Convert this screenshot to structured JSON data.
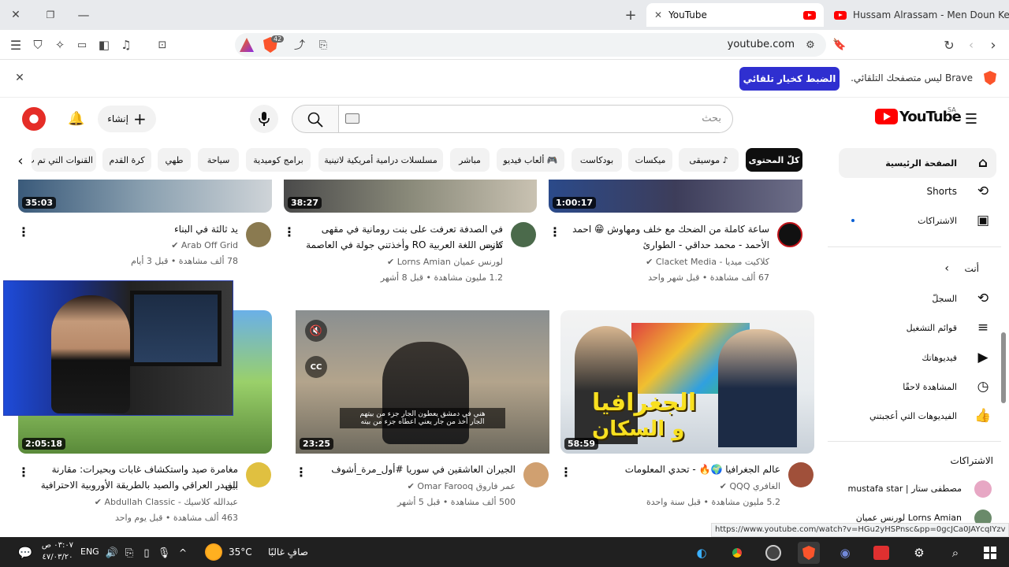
{
  "browser": {
    "tabs": [
      {
        "label": "YouTube"
      },
      {
        "label": "Hussam Alrassam - Men Doun Kel Lb"
      }
    ],
    "address": "youtube.com",
    "shield_count": "42"
  },
  "notice": {
    "text": "Brave ليس متصفحك التلقائي.",
    "button": "الضبط كخيار تلقائي"
  },
  "header": {
    "logo": "YouTube",
    "region": "SA",
    "search_placeholder": "بحث",
    "create_label": "إنشاء"
  },
  "chips": [
    "كلّ المحتوى",
    "موسيقى",
    "ميكسات",
    "بودكاست",
    "ألعاب فيديو",
    "مباشر",
    "مسلسلات درامية أمريكية لاتينية",
    "برامج كوميدية",
    "سياحة",
    "طهي",
    "كرة القدم",
    "القنوات التي تم ت"
  ],
  "sidebar": {
    "main": [
      {
        "label": "الصفحة الرئيسية",
        "icon": "home-icon"
      },
      {
        "label": "Shorts",
        "icon": "shorts-icon"
      },
      {
        "label": "الاشتراكات",
        "icon": "subscriptions-icon"
      }
    ],
    "you_label": "أنت",
    "you_items": [
      {
        "label": "السجلّ",
        "icon": "history-icon"
      },
      {
        "label": "قوائم التشغيل",
        "icon": "playlist-icon"
      },
      {
        "label": "فيديوهاتك",
        "icon": "your-videos-icon"
      },
      {
        "label": "المشاهدة لاحقًا",
        "icon": "watch-later-icon"
      },
      {
        "label": "الفيديوهات التي أعجبتني",
        "icon": "like-icon"
      }
    ],
    "subs_label": "الاشتراكات",
    "subs": [
      {
        "label": "mustafa star | مصطفى ستار"
      },
      {
        "label": "لورنس عميان Lorns Amian"
      }
    ]
  },
  "videos_row1": [
    {
      "duration": "1:00:17",
      "title1": "ساعة كاملة من الضحك مع خلف ومهاوش 😁 احمد",
      "title2": "الأحمد - محمد حداقي - الطوارئ",
      "channel": "كلاكيت ميديا - Clacket Media",
      "meta": "67 ألف مشاهدة • قبل شهر واحد"
    },
    {
      "duration": "38:27",
      "title1": "في الصدفة تعرفت على بنت رومانية في مقهى كانت",
      "title2": "تدرس اللغة العربية RO وأخذتني جولة في العاصمة",
      "channel": "لورنس عميان Lorns Amian",
      "meta": "1.2 مليون مشاهدة • قبل 8 أشهر"
    },
    {
      "duration": "35:03",
      "title1": "يد ثالثة في البناء",
      "title2": "",
      "channel": "Arab Off Grid",
      "meta": "78 ألف مشاهدة • قبل 3 أيام"
    }
  ],
  "videos_row2": [
    {
      "duration": "58:59",
      "title1": "عالم الجغرافيا 🌍🔥 - تحدي المعلومات",
      "channel": "الغافري QQQ",
      "meta": "5.2 مليون مشاهدة • قبل سنة واحدة",
      "thumb_text1": "الجغرافيا",
      "thumb_text2": "و السكان"
    },
    {
      "duration": "23:25",
      "title1": "الجيران العاشقين في سوريا #أول_مرة_أشوف",
      "channel": "عمر فاروق Omar Farooq",
      "meta": "500 ألف مشاهدة • قبل 5 أشهر",
      "caption1": "هني في دمشق يعطون الجار جزء من بيتهم",
      "caption2": "الجار أخذ من جار يعني اعطاه جزء من بيته"
    },
    {
      "duration": "2:05:18",
      "title1": "مغامرة صيد واستكشاف غابات وبحيرات: مقارنة بين",
      "title2": "الفيدر العراقي والصيد بالطريقة الأوروبية الاحترافية",
      "channel": "عبدالله كلاسيك - Abdullah Classic",
      "meta": "463 ألف مشاهدة • قبل يوم واحد"
    }
  ],
  "status_url": "https://www.youtube.com/watch?v=HGu2yHSPnsc&pp=0gcJCa0JAYcqIYzv",
  "taskbar": {
    "weather_temp": "35°C",
    "weather_text": "صافٍ غالبًا",
    "lang": "ENG",
    "time": "٠٣:٠٧ ص",
    "date": "٤٧/٠٣/٢٠"
  },
  "colors": {
    "accent": "#ff0000",
    "brave_button": "#2f2fd0"
  }
}
